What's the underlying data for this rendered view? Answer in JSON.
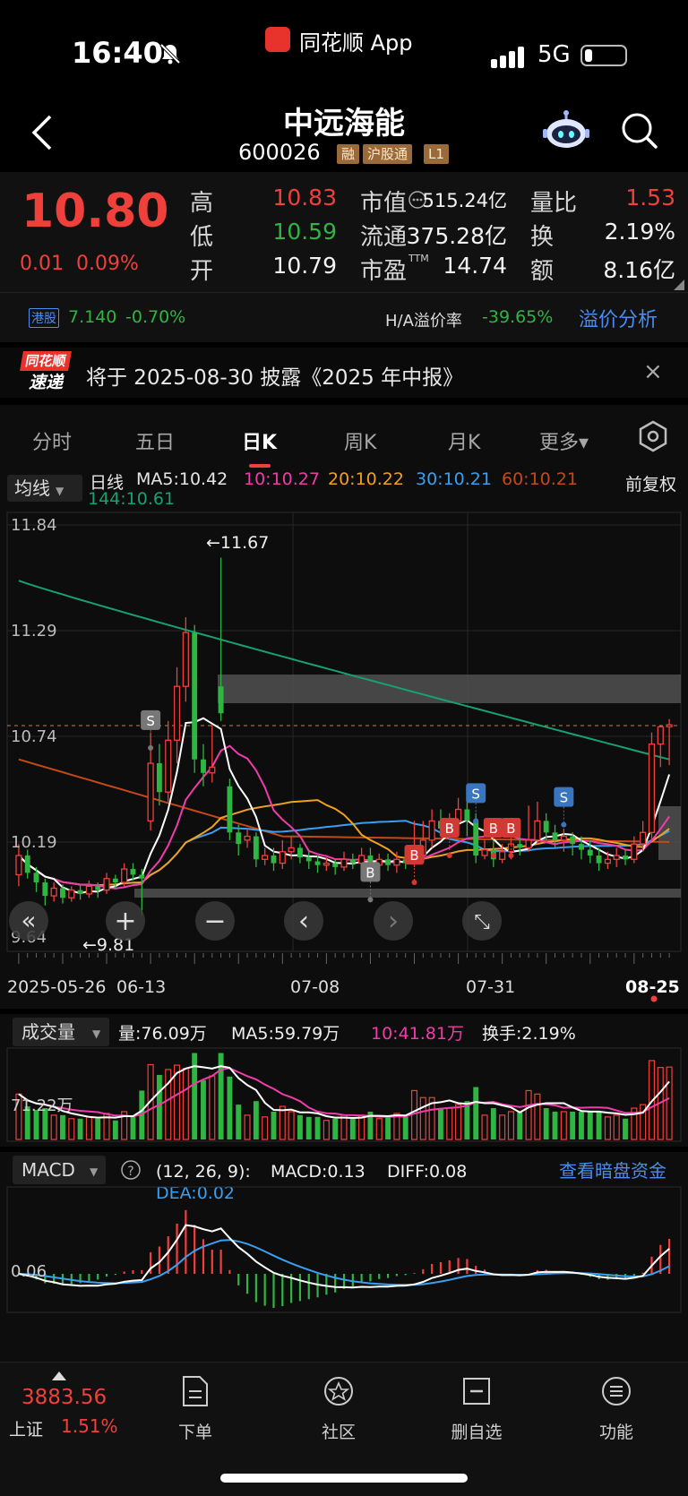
{
  "status_bar": {
    "time": "16:40",
    "app_name": "同花顺 App",
    "network": "5G"
  },
  "header": {
    "title": "中远海能",
    "code": "600026",
    "tags": [
      "融",
      "沪股通",
      "L1"
    ]
  },
  "quote": {
    "price": "10.80",
    "change": "0.01",
    "change_pct": "0.09%",
    "rows": [
      {
        "l1": "高",
        "v1": "10.83",
        "l2": "市值",
        "v2": "515.24亿",
        "l3": "量比",
        "v3": "1.53"
      },
      {
        "l1": "低",
        "v1": "10.59",
        "l2": "流通",
        "v2": "375.28亿",
        "l3": "换",
        "v3": "2.19%"
      },
      {
        "l1": "开",
        "v1": "10.79",
        "l2": "市盈",
        "v2": "14.74",
        "l3": "额",
        "v3": "8.16亿"
      }
    ],
    "pe_suffix": "TTM"
  },
  "hk": {
    "tag": "港股",
    "price": "7.140",
    "pct": "-0.70%",
    "premium_label": "H/A溢价率",
    "premium_value": "-39.65%",
    "analysis_link": "溢价分析"
  },
  "notice": {
    "logo_top": "同花顺",
    "logo_bottom": "速递",
    "text": "将于 2025-08-30 披露《2025 年中报》",
    "close": "×"
  },
  "tabs": [
    {
      "label": "分时",
      "active": false
    },
    {
      "label": "五日",
      "active": false
    },
    {
      "label": "日K",
      "active": true
    },
    {
      "label": "周K",
      "active": false
    },
    {
      "label": "月K",
      "active": false
    },
    {
      "label": "更多▾",
      "active": false
    }
  ],
  "ma_legend": {
    "selector": "均线",
    "period": "日线",
    "ma5": "MA5:10.42",
    "ma10": "10:10.27",
    "ma20": "20:10.22",
    "ma30": "30:10.21",
    "ma60": "60:10.21",
    "ma144": "144:10.61",
    "adjust": "前复权"
  },
  "kline": {
    "y_labels": [
      "11.84",
      "11.29",
      "10.74",
      "10.19",
      "9.64"
    ],
    "high_marker": "←11.67",
    "low_marker": "←9.81",
    "x_labels": [
      "2025-05-26",
      "06-13",
      "07-08",
      "07-31",
      "08-25"
    ],
    "colors": {
      "up": "#f0403c",
      "down": "#2fb541",
      "ma5": "#ffffff",
      "ma10": "#f03caa",
      "ma20": "#f0a020",
      "ma30": "#3a9ff0",
      "ma60": "#c24a18",
      "ma144": "#18a070"
    },
    "candles": [
      [
        10.02,
        10.12,
        10.18,
        9.96
      ],
      [
        10.12,
        10.03,
        10.15,
        10.0
      ],
      [
        10.03,
        9.98,
        10.06,
        9.93
      ],
      [
        9.98,
        9.91,
        10.0,
        9.86
      ],
      [
        9.91,
        9.95,
        9.98,
        9.88
      ],
      [
        9.95,
        9.9,
        9.97,
        9.87
      ],
      [
        9.9,
        9.94,
        9.96,
        9.88
      ],
      [
        9.94,
        9.92,
        9.97,
        9.89
      ],
      [
        9.92,
        9.96,
        9.99,
        9.9
      ],
      [
        9.96,
        9.94,
        9.98,
        9.9
      ],
      [
        9.94,
        10.0,
        10.03,
        9.92
      ],
      [
        10.0,
        9.98,
        10.02,
        9.95
      ],
      [
        9.98,
        10.05,
        10.08,
        9.96
      ],
      [
        10.05,
        10.02,
        10.08,
        9.99
      ],
      [
        10.02,
        10.0,
        10.05,
        9.81
      ],
      [
        10.3,
        10.6,
        10.76,
        10.25
      ],
      [
        10.6,
        10.45,
        10.7,
        10.38
      ],
      [
        10.45,
        10.72,
        10.82,
        10.4
      ],
      [
        10.72,
        11.0,
        11.1,
        10.6
      ],
      [
        11.0,
        11.28,
        11.36,
        10.92
      ],
      [
        11.28,
        10.62,
        11.32,
        10.55
      ],
      [
        10.62,
        10.55,
        10.7,
        10.48
      ],
      [
        10.55,
        10.58,
        10.8,
        10.5
      ],
      [
        11.0,
        10.86,
        11.67,
        10.82
      ],
      [
        10.48,
        10.24,
        10.52,
        10.2
      ],
      [
        10.24,
        10.18,
        10.28,
        10.12
      ],
      [
        10.2,
        10.22,
        10.26,
        10.16
      ],
      [
        10.22,
        10.1,
        10.24,
        10.06
      ],
      [
        10.1,
        10.12,
        10.16,
        10.07
      ],
      [
        10.12,
        10.08,
        10.16,
        10.04
      ],
      [
        10.08,
        10.14,
        10.2,
        10.05
      ],
      [
        10.14,
        10.16,
        10.22,
        10.1
      ],
      [
        10.16,
        10.11,
        10.18,
        10.08
      ],
      [
        10.11,
        10.09,
        10.14,
        10.05
      ],
      [
        10.09,
        10.07,
        10.12,
        10.03
      ],
      [
        10.07,
        10.08,
        10.11,
        10.04
      ],
      [
        10.08,
        10.06,
        10.1,
        10.02
      ],
      [
        10.06,
        10.1,
        10.14,
        10.04
      ],
      [
        10.1,
        10.08,
        10.13,
        10.05
      ],
      [
        10.08,
        10.12,
        10.16,
        10.06
      ],
      [
        10.12,
        10.07,
        10.16,
        10.04
      ],
      [
        10.07,
        10.1,
        10.13,
        10.05
      ],
      [
        10.1,
        10.07,
        10.13,
        10.04
      ],
      [
        10.07,
        10.1,
        10.14,
        10.03
      ],
      [
        10.1,
        10.08,
        10.14,
        10.05
      ],
      [
        10.08,
        10.12,
        10.3,
        10.06
      ],
      [
        10.12,
        10.2,
        10.3,
        10.1
      ],
      [
        10.2,
        10.3,
        10.36,
        10.16
      ],
      [
        10.3,
        10.26,
        10.36,
        10.22
      ],
      [
        10.26,
        10.3,
        10.34,
        10.2
      ],
      [
        10.3,
        10.36,
        10.42,
        10.26
      ],
      [
        10.36,
        10.3,
        10.4,
        10.22
      ],
      [
        10.3,
        10.12,
        10.34,
        10.08
      ],
      [
        10.12,
        10.15,
        10.2,
        10.1
      ],
      [
        10.15,
        10.1,
        10.2,
        10.06
      ],
      [
        10.1,
        10.14,
        10.18,
        10.08
      ],
      [
        10.14,
        10.18,
        10.22,
        10.1
      ],
      [
        10.18,
        10.16,
        10.24,
        10.12
      ],
      [
        10.16,
        10.2,
        10.38,
        10.14
      ],
      [
        10.2,
        10.3,
        10.4,
        10.18
      ],
      [
        10.3,
        10.24,
        10.34,
        10.2
      ],
      [
        10.24,
        10.2,
        10.28,
        10.16
      ],
      [
        10.2,
        10.22,
        10.26,
        10.14
      ],
      [
        10.22,
        10.18,
        10.24,
        10.12
      ],
      [
        10.18,
        10.15,
        10.22,
        10.1
      ],
      [
        10.15,
        10.12,
        10.2,
        10.08
      ],
      [
        10.12,
        10.08,
        10.16,
        10.04
      ],
      [
        10.08,
        10.1,
        10.14,
        10.05
      ],
      [
        10.1,
        10.12,
        10.16,
        10.06
      ],
      [
        10.12,
        10.1,
        10.15,
        10.07
      ],
      [
        10.1,
        10.18,
        10.22,
        10.08
      ],
      [
        10.18,
        10.24,
        10.3,
        10.14
      ],
      [
        10.24,
        10.7,
        10.76,
        10.2
      ],
      [
        10.7,
        10.79,
        10.8,
        10.58
      ],
      [
        10.79,
        10.8,
        10.83,
        10.59
      ]
    ],
    "signals": [
      {
        "type": "S",
        "i": 15,
        "price": 10.82
      },
      {
        "type": "B",
        "i": 40,
        "price": 10.03
      },
      {
        "type": "B",
        "i": 45,
        "price": 10.12
      },
      {
        "type": "B",
        "i": 49,
        "price": 10.26
      },
      {
        "type": "S",
        "i": 52,
        "price": 10.44
      },
      {
        "type": "B",
        "i": 54,
        "price": 10.26
      },
      {
        "type": "B",
        "i": 56,
        "price": 10.26
      },
      {
        "type": "S",
        "i": 62,
        "price": 10.42
      }
    ]
  },
  "chart_controls": [
    "«",
    "+",
    "−",
    "‹",
    "›",
    "⤡"
  ],
  "volume": {
    "selector": "成交量",
    "vol": "量:76.09万",
    "ma5": "MA5:59.79万",
    "ma10": "10:41.81万",
    "turnover": "换手:2.19%",
    "y_label": "71.22万"
  },
  "macd": {
    "selector": "MACD",
    "params": "(12, 26, 9):",
    "macd": "MACD:0.13",
    "diff": "DIFF:0.08",
    "dea": "DEA:0.02",
    "y_label": "0.06",
    "dark_pool_link": "查看暗盘资金"
  },
  "bottom_nav": {
    "index_value": "3883.56",
    "index_name": "上证",
    "index_pct": "1.51%",
    "items": [
      "下单",
      "社区",
      "删自选",
      "功能"
    ]
  }
}
